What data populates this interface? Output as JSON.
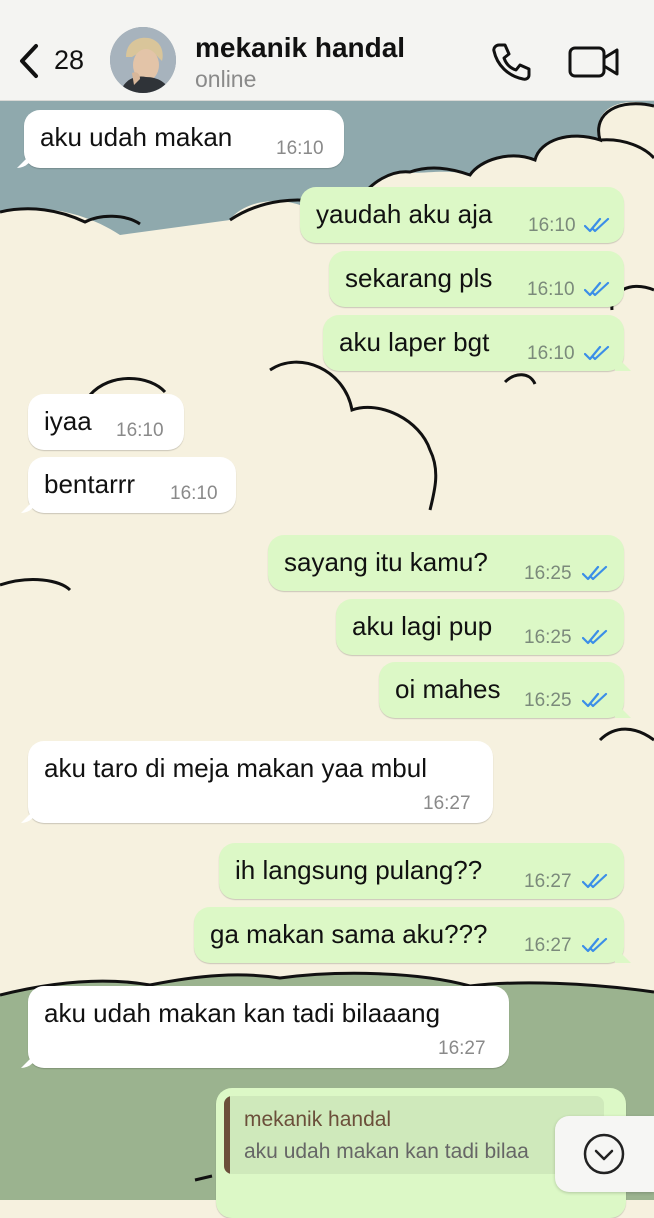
{
  "header": {
    "back_count": "28",
    "contact_name": "mekanik handal",
    "status": "online"
  },
  "icons": {
    "back": "chevron-left-icon",
    "call": "phone-icon",
    "video": "video-camera-icon",
    "read": "double-check-icon",
    "scroll": "chevron-down-icon"
  },
  "colors": {
    "incoming_bubble": "#ffffff",
    "outgoing_bubble": "#dcf8c6",
    "read_ticks": "#3b8ee8",
    "sky": "#8fa9ad",
    "cloud": "#f6f1df",
    "hill": "#9bb38f"
  },
  "messages": [
    {
      "dir": "in",
      "text": "aku udah makan",
      "time": "16:10"
    },
    {
      "dir": "out",
      "text": "yaudah aku aja",
      "time": "16:10"
    },
    {
      "dir": "out",
      "text": "sekarang pls",
      "time": "16:10"
    },
    {
      "dir": "out",
      "text": "aku laper bgt",
      "time": "16:10"
    },
    {
      "dir": "in",
      "text": "iyaa",
      "time": "16:10"
    },
    {
      "dir": "in",
      "text": "bentarrr",
      "time": "16:10"
    },
    {
      "dir": "out",
      "text": "sayang itu kamu?",
      "time": "16:25"
    },
    {
      "dir": "out",
      "text": "aku lagi pup",
      "time": "16:25"
    },
    {
      "dir": "out",
      "text": "oi mahes",
      "time": "16:25"
    },
    {
      "dir": "in",
      "text": "aku taro di meja makan yaa mbul",
      "time": "16:27"
    },
    {
      "dir": "out",
      "text": "ih langsung pulang??",
      "time": "16:27"
    },
    {
      "dir": "out",
      "text": "ga makan sama aku???",
      "time": "16:27"
    },
    {
      "dir": "in",
      "text": "aku udah makan kan tadi bilaaang",
      "time": "16:27"
    }
  ],
  "reply": {
    "quoted_name": "mekanik handal",
    "quoted_text": "aku udah makan kan tadi bilaa"
  }
}
